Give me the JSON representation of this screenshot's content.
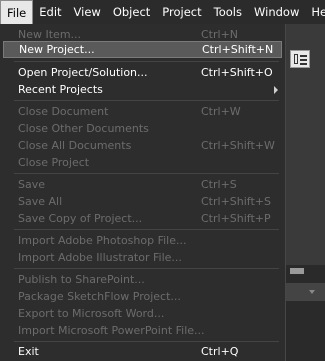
{
  "menubar": {
    "items": [
      "File",
      "Edit",
      "View",
      "Object",
      "Project",
      "Tools",
      "Window",
      "Help"
    ]
  },
  "file_menu": {
    "new_item": {
      "label": "New Item...",
      "shortcut": "Ctrl+N"
    },
    "new_project": {
      "label": "New Project...",
      "shortcut": "Ctrl+Shift+N"
    },
    "open_project": {
      "label": "Open Project/Solution...",
      "shortcut": "Ctrl+Shift+O"
    },
    "recent_projects": {
      "label": "Recent Projects"
    },
    "close_document": {
      "label": "Close Document",
      "shortcut": "Ctrl+W"
    },
    "close_other_documents": {
      "label": "Close Other Documents"
    },
    "close_all_documents": {
      "label": "Close All Documents",
      "shortcut": "Ctrl+Shift+W"
    },
    "close_project": {
      "label": "Close Project"
    },
    "save": {
      "label": "Save",
      "shortcut": "Ctrl+S"
    },
    "save_all": {
      "label": "Save All",
      "shortcut": "Ctrl+Shift+S"
    },
    "save_copy": {
      "label": "Save Copy of Project...",
      "shortcut": "Ctrl+Shift+P"
    },
    "import_photoshop": {
      "label": "Import Adobe Photoshop File..."
    },
    "import_illustrator": {
      "label": "Import Adobe Illustrator File..."
    },
    "publish_sharepoint": {
      "label": "Publish to SharePoint..."
    },
    "package_sketchflow": {
      "label": "Package SketchFlow Project..."
    },
    "export_word": {
      "label": "Export to Microsoft Word..."
    },
    "import_powerpoint": {
      "label": "Import Microsoft PowerPoint File..."
    },
    "exit": {
      "label": "Exit",
      "shortcut": "Ctrl+Q"
    }
  },
  "colors": {
    "menu_bg": "#2d2d2d",
    "enabled_text": "#ffffff",
    "disabled_text": "#6c6c6c",
    "highlight_bg": "#5a5a5a"
  },
  "icons": {
    "submenu_arrow": "chevron-right-icon",
    "panel_toggle": "panel-layout-icon"
  }
}
